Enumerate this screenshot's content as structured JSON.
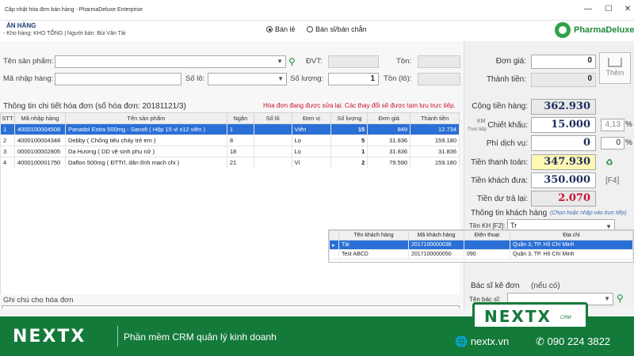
{
  "window": {
    "title": "Cập nhật hóa đơn bán hàng - PharmaDeluxe Enterprise",
    "min": "—",
    "max": "☐",
    "close": "✕"
  },
  "header": {
    "title": "ÁN HÀNG",
    "store_line": "- Kho hàng: KHO TỔNG | Người bán: Bùi Văn Tài",
    "radio_retail": "Bán lẻ",
    "radio_wholesale": "Bán sỉ/bán chẵn",
    "logo_text": "PharmaDeluxe"
  },
  "form": {
    "product_name_label": "Tên sản phẩm:",
    "dvt_label": "ĐVT:",
    "ton_label": "Tồn:",
    "import_code_label": "Mã nhập hàng:",
    "lot_label": "Số lô:",
    "qty_label": "Số lượng:",
    "qty_value": "1",
    "lot_stock_label": "Tồn (lô):"
  },
  "pricing": {
    "unit_price_label": "Đơn giá:",
    "unit_price_value": "0",
    "amount_label": "Thành tiền:",
    "amount_value": "0",
    "add_button": "Thêm",
    "total_label": "Cộng tiền hàng:",
    "total_value": "362.930",
    "km_label": "KM",
    "discount_sub": "Trực tiếp",
    "discount_label": "Chiết khấu:",
    "discount_value": "15.000",
    "discount_pct": "4,13",
    "pct_sign": "%",
    "service_label": "Phí dịch vụ:",
    "service_value": "0",
    "service_pct": "0",
    "payable_label": "Tiền thanh toán:",
    "payable_value": "347.930",
    "paid_label": "Tiền khách đưa:",
    "paid_value": "350.000",
    "paid_hint": "[F4]",
    "change_label": "Tiền dư trả lại:",
    "change_value": "2.070"
  },
  "invoice": {
    "title": "Thông tin chi tiết hóa đơn  (số hóa đơn: 20181121/3)",
    "warning": "Hóa đơn đang được sửa lại. Các thay đổi sẽ được tạm lưu trực tiếp.",
    "columns": [
      "STT",
      "Mã nhập hàng",
      "Tên sản phẩm",
      "Ngân",
      "Số lô",
      "Đơn vị",
      "Số lượng",
      "Đơn giá",
      "Thành tiền"
    ],
    "rows": [
      [
        "1",
        "4000100004508",
        "Panadol Extra 500mg - Sanofi ( Hộp 15 vỉ x12 viên )",
        "1",
        "",
        "Viên",
        "15",
        "849",
        "12.734"
      ],
      [
        "2",
        "4000100004348",
        "Debby ( Chống tiêu chảy trẻ em )",
        "8",
        "",
        "Lọ",
        "5",
        "31.836",
        "159.180"
      ],
      [
        "3",
        "0000100002805",
        "Da Hương ( DD vệ sinh phụ nữ )",
        "18",
        "",
        "Lọ",
        "1",
        "31.836",
        "31.836"
      ],
      [
        "4",
        "4000100001750",
        "Daflon 500mg ( ĐTTrĩ, dãn tĩnh mạch chi )",
        "21",
        "",
        "Vỉ",
        "2",
        "79.590",
        "159.180"
      ]
    ]
  },
  "customer": {
    "section_title": "Thông tin khách hàng",
    "section_hint": "(Chọn hoặc nhập vào trực tiếp)",
    "name_label": "Tên KH [F2]:",
    "name_value": "Tr",
    "popup_columns": [
      "Tên khách hàng",
      "Mã khách hàng",
      "Điện thoại",
      "Địa chỉ"
    ],
    "popup_rows": [
      [
        "Tài",
        "2017100000036",
        "",
        "Quận 3, TP. Hồ Chí Minh"
      ],
      [
        "Test ABCD",
        "2017100000050",
        "090",
        "Quận 3, TP. Hồ Chí Minh"
      ]
    ]
  },
  "doctor": {
    "section_title": "Bác sĩ kê đơn",
    "section_hint": "(nếu có)",
    "name_label": "Tên bác sĩ:"
  },
  "note": {
    "label": "Ghi chú cho hóa đơn"
  },
  "footer": {
    "brand": "NEXTX",
    "slogan": "Phần mềm CRM quản lý kinh doanh",
    "website": "nextx.vn",
    "phone": "090 224 3822",
    "badge_text": "NEXTX",
    "badge_sub": "CRM"
  },
  "colors": {
    "accent": "#147a3a",
    "selection": "#2a6fd6",
    "warning": "#c8102e",
    "payable_bg": "#fff7b3"
  }
}
